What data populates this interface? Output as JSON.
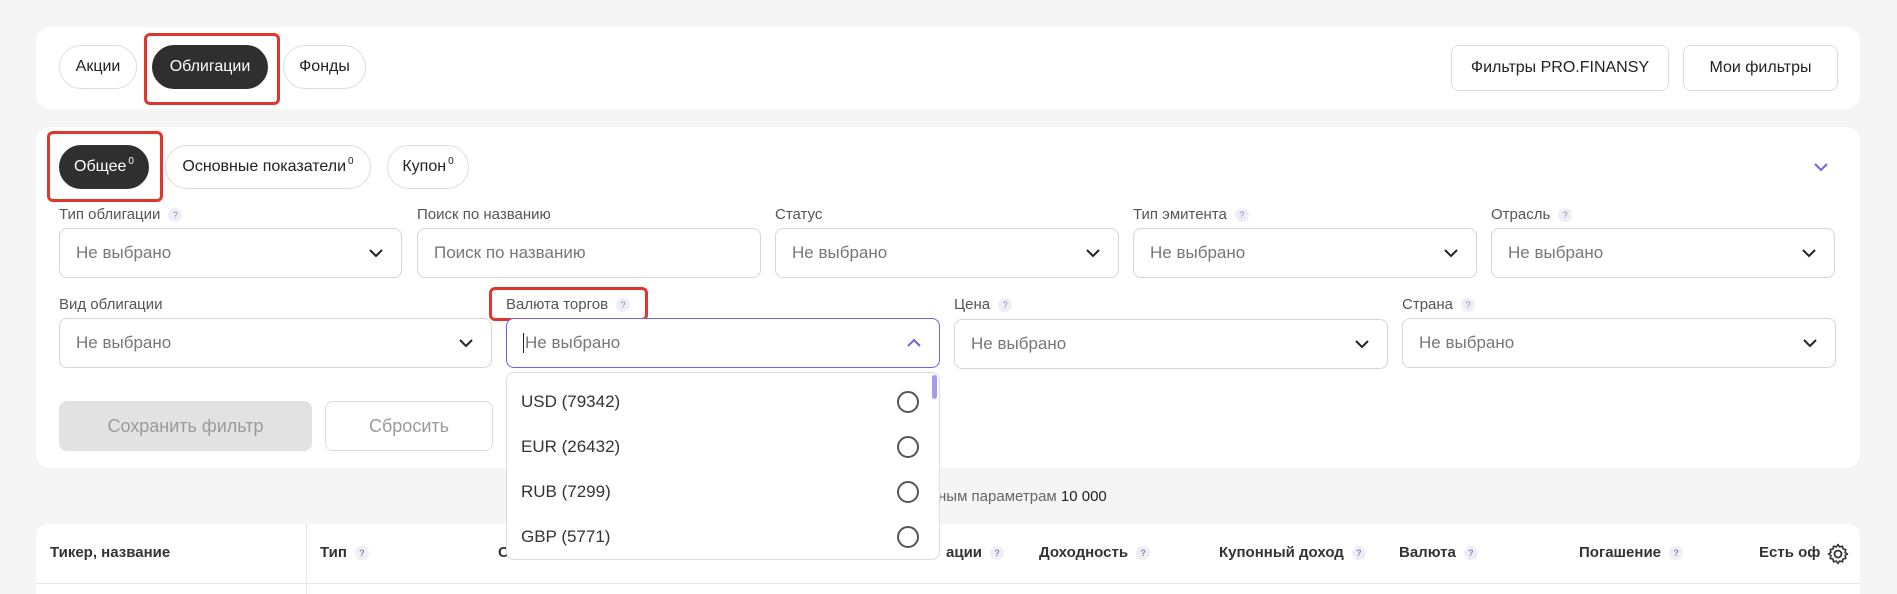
{
  "asset_tabs": {
    "stocks": "Акции",
    "bonds": "Облигации",
    "funds": "Фонды"
  },
  "top_actions": {
    "pro_filters": "Фильтры PRO.FINANSY",
    "my_filters": "Мои фильтры"
  },
  "filter_tabs": [
    {
      "label": "Общее",
      "count": "0"
    },
    {
      "label": "Основные показатели",
      "count": "0"
    },
    {
      "label": "Купон",
      "count": "0"
    }
  ],
  "fields": {
    "bond_type": {
      "label": "Тип облигации",
      "value": "Не выбрано"
    },
    "search": {
      "label": "Поиск по названию",
      "placeholder": "Поиск по названию"
    },
    "status": {
      "label": "Статус",
      "value": "Не выбрано"
    },
    "issuer_type": {
      "label": "Тип эмитента",
      "value": "Не выбрано"
    },
    "industry": {
      "label": "Отрасль",
      "value": "Не выбрано"
    },
    "bond_kind": {
      "label": "Вид облигации",
      "value": "Не выбрано"
    },
    "currency": {
      "label": "Валюта торгов",
      "value": "Не выбрано"
    },
    "price": {
      "label": "Цена",
      "value": "Не выбрано"
    },
    "country": {
      "label": "Страна",
      "value": "Не выбрано"
    }
  },
  "currency_options": [
    {
      "label": "USD (79342)"
    },
    {
      "label": "EUR (26432)"
    },
    {
      "label": "RUB (7299)"
    },
    {
      "label": "GBP (5771)"
    }
  ],
  "actions": {
    "save": "Сохранить фильтр",
    "reset": "Сбросить"
  },
  "results": {
    "text": "ным параметрам",
    "count": "10 000"
  },
  "table_headers": {
    "ticker": "Тикер, название",
    "type": "Тип",
    "col_partial_a": "С",
    "col_partial_b": "ации",
    "yield": "Доходность",
    "coupon_income": "Купонный доход",
    "currency": "Валюта",
    "maturity": "Погашение",
    "offer": "Есть оф"
  },
  "colors": {
    "accent": "#6f63e6",
    "highlight": "#e0362c",
    "dark_pill": "#2f2f2f"
  },
  "icons": {
    "chevron": "chevron-down-icon",
    "settings": "gear-icon"
  }
}
